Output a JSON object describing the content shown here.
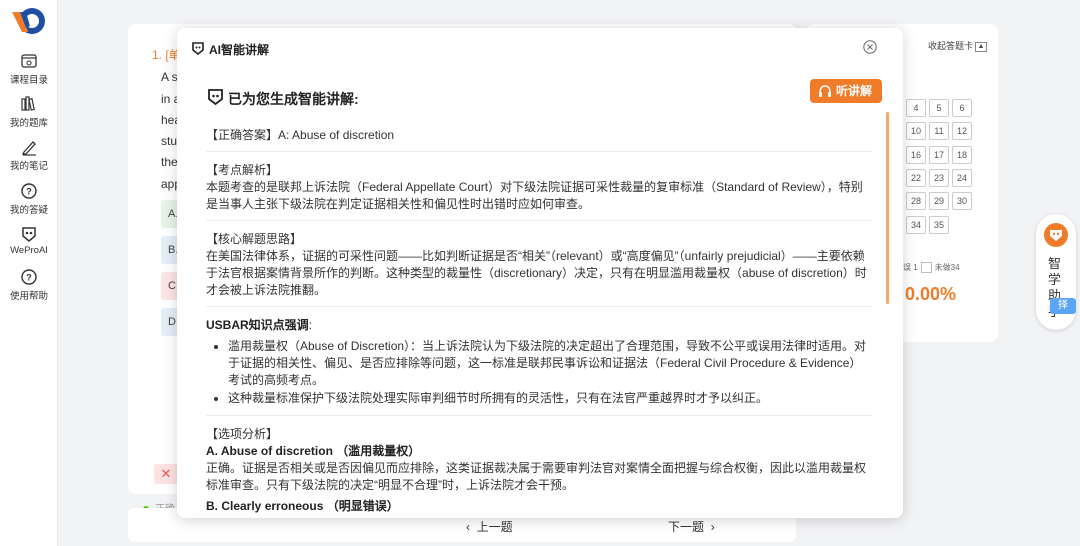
{
  "nav": {
    "items": [
      {
        "label": "课程目录",
        "icon": "course-catalog-icon"
      },
      {
        "label": "我的题库",
        "icon": "question-bank-icon"
      },
      {
        "label": "我的笔记",
        "icon": "pen-icon"
      },
      {
        "label": "我的答疑",
        "icon": "question-bubble-icon"
      },
      {
        "label": "WeProAI",
        "icon": "weproai-icon"
      },
      {
        "label": "使用帮助",
        "icon": "help-icon"
      }
    ]
  },
  "question": {
    "title": "1. [单",
    "lines": [
      "A s",
      "in a",
      "hea",
      "stu",
      "the",
      "app"
    ],
    "options": [
      "A.",
      "B.",
      "C.",
      "D."
    ],
    "wrong_mark": "✕",
    "status": "正确",
    "prev": "上一题",
    "next": "下一题"
  },
  "answer_card": {
    "collapse": "收起答题卡",
    "numbers": [
      "4",
      "5",
      "6",
      "10",
      "11",
      "12",
      "16",
      "17",
      "18",
      "22",
      "23",
      "24",
      "28",
      "29",
      "30",
      "34",
      "35"
    ],
    "wrong_label": "误 1",
    "unanswered_label": "未做34",
    "accuracy": "0.00%"
  },
  "assistant": {
    "text": "智学助手",
    "tag": "择"
  },
  "modal": {
    "title": "AI智能讲解",
    "generated_title": "已为您生成智能讲解:",
    "listen_label": "听讲解",
    "correct_answer": "【正确答案】A: Abuse of discretion",
    "analysis_header": "【考点解析】",
    "analysis_text": "本题考查的是联邦上诉法院（Federal Appellate Court）对下级法院证据可采性裁量的复审标准（Standard of Review），特别是当事人主张下级法院在判定证据相关性和偏见性时出错时应如何审查。",
    "approach_header": "【核心解题思路】",
    "approach_text": "在美国法律体系，证据的可采性问题——比如判断证据是否“相关”（relevant）或“高度偏见”（unfairly prejudicial）——主要依赖于法官根据案情背景所作的判断。这种类型的裁量性（discretionary）决定，只有在明显滥用裁量权（abuse of discretion）时才会被上诉法院推翻。",
    "usbar_header": "USBAR知识点强调",
    "usbar_colon": ":",
    "usbar_points": [
      "滥用裁量权（Abuse of Discretion）：当上诉法院认为下级法院的决定超出了合理范围，导致不公平或误用法律时适用。对于证据的相关性、偏见、是否应排除等问题，这一标准是联邦民事诉讼和证据法（Federal Civil Procedure & Evidence）考试的高频考点。",
      "这种裁量标准保护下级法院处理实际审判细节时所拥有的灵活性，只有在法官严重越界时才予以纠正。"
    ],
    "options_header": "【选项分析】",
    "option_a_title": "A. Abuse of discretion （滥用裁量权）",
    "option_a_text": "正确。证据是否相关或是否因偏见而应排除，这类证据裁决属于需要审判法官对案情全面把握与综合权衡，因此以滥用裁量权标准审查。只有下级法院的决定“明显不合理”时，上诉法院才会干预。",
    "option_b_title": "B. Clearly erroneous （明显错误）"
  },
  "colors": {
    "accent": "#f07c2a",
    "brand_blue": "#1f4fa3"
  }
}
